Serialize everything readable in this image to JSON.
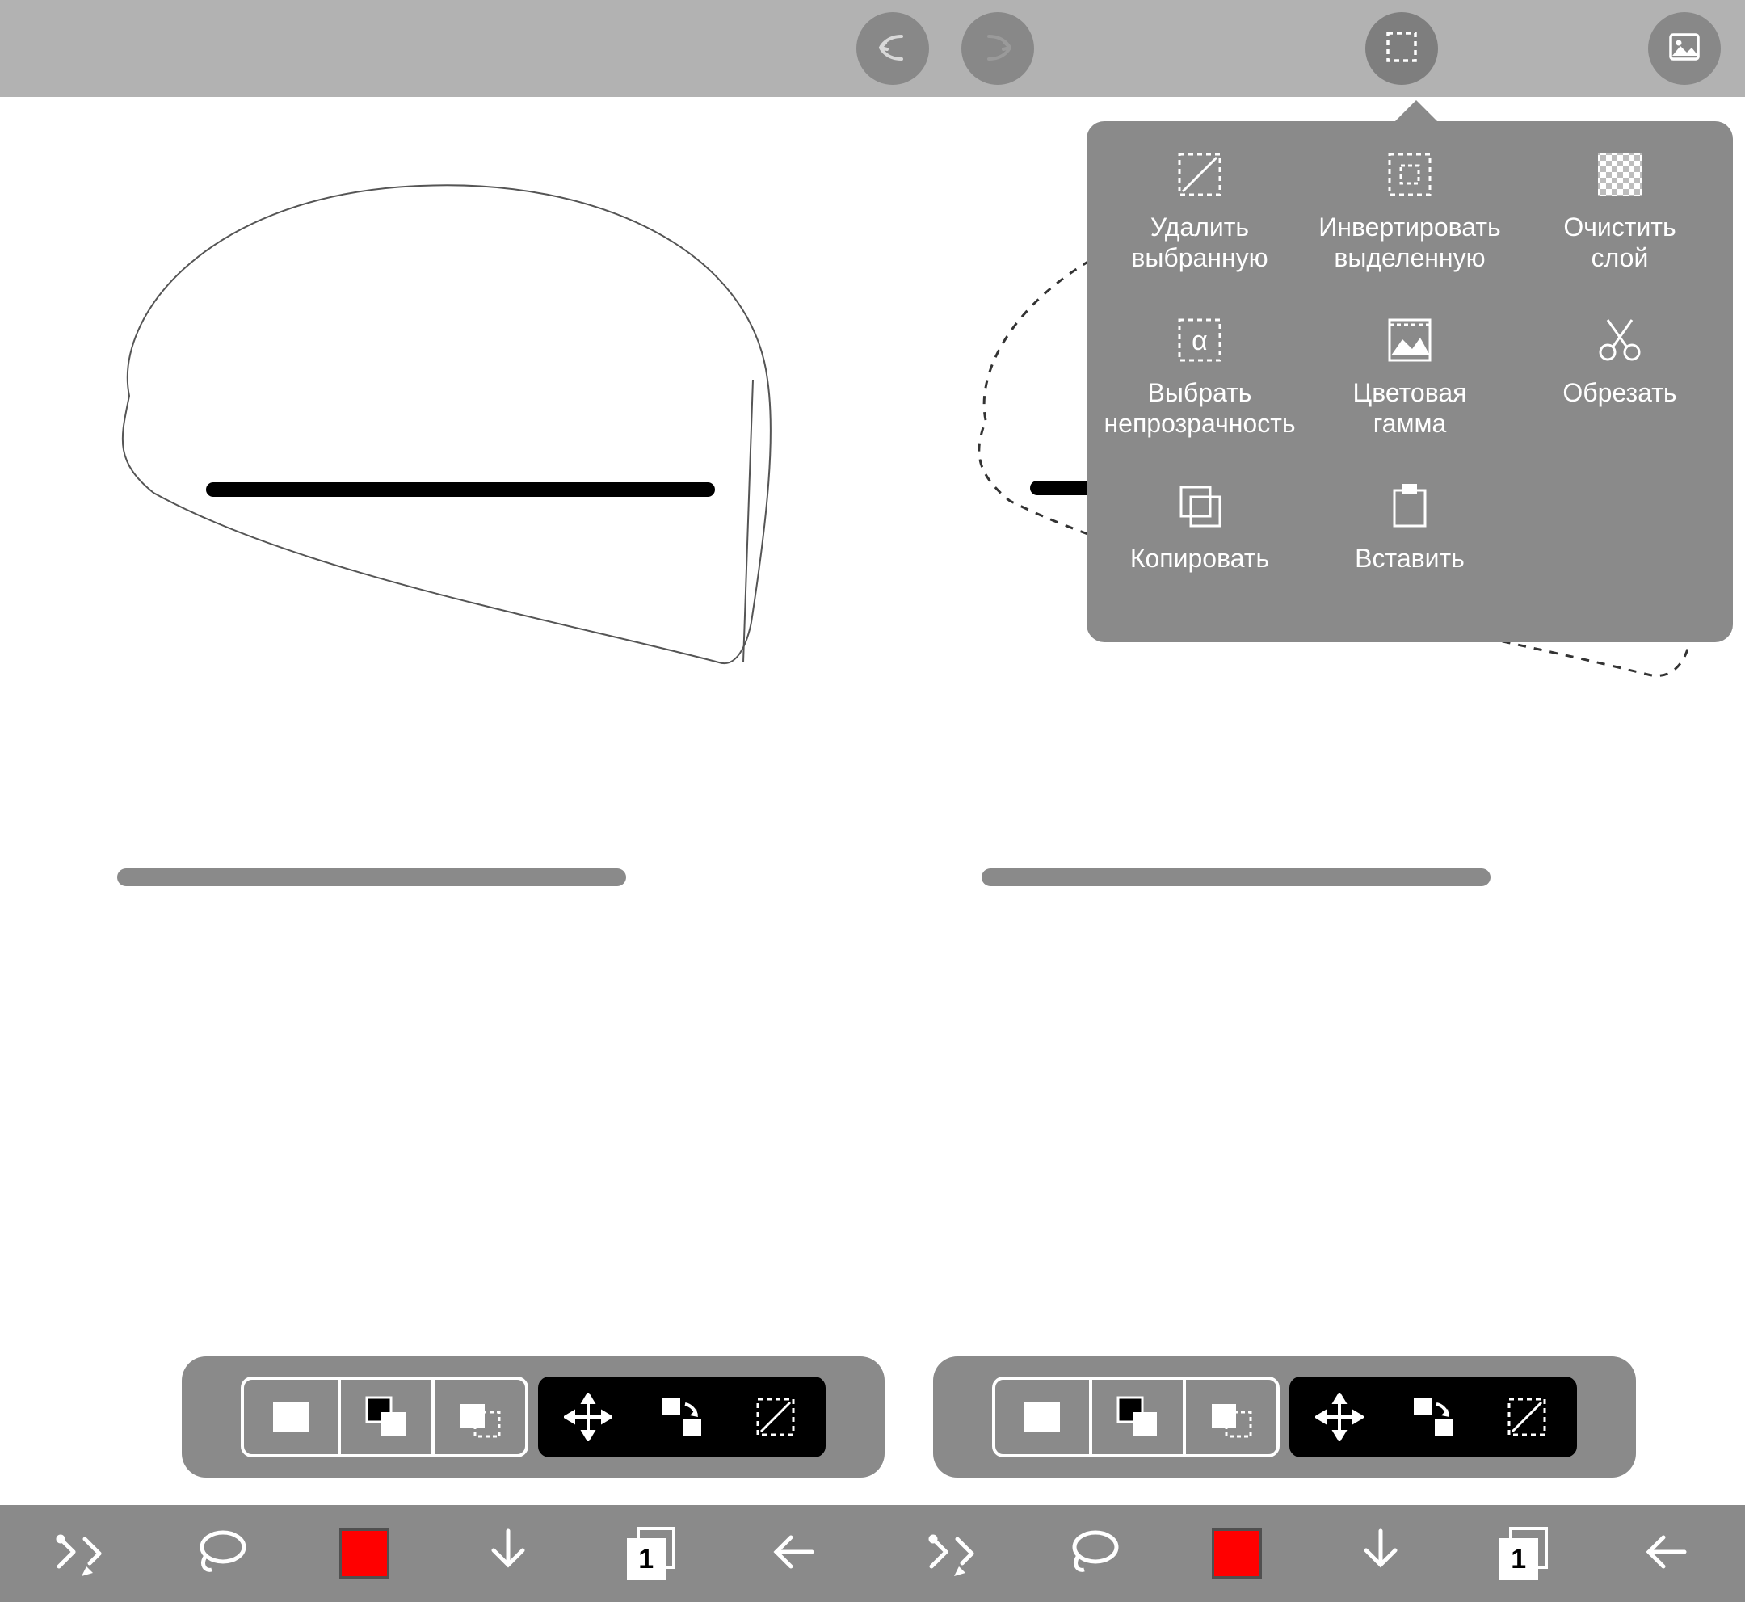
{
  "topbar": {
    "undo_icon": "undo-icon",
    "redo_icon": "redo-icon",
    "selection_icon": "selection-icon",
    "gallery_icon": "gallery-icon"
  },
  "popover": {
    "items": [
      {
        "label": "Удалить\nвыбранную",
        "icon": "delete-selection-icon"
      },
      {
        "label": "Инвертировать\nвыделенную",
        "icon": "invert-selection-icon"
      },
      {
        "label": "Очистить\nслой",
        "icon": "clear-layer-icon"
      },
      {
        "label": "Выбрать\nнепрозрачность",
        "icon": "select-alpha-icon"
      },
      {
        "label": "Цветовая\nгамма",
        "icon": "color-range-icon"
      },
      {
        "label": "Обрезать",
        "icon": "crop-icon"
      },
      {
        "label": "Копировать",
        "icon": "copy-icon"
      },
      {
        "label": "Вставить",
        "icon": "paste-icon"
      }
    ]
  },
  "bottom": {
    "layer_number": "1",
    "color": "#ff0000"
  }
}
